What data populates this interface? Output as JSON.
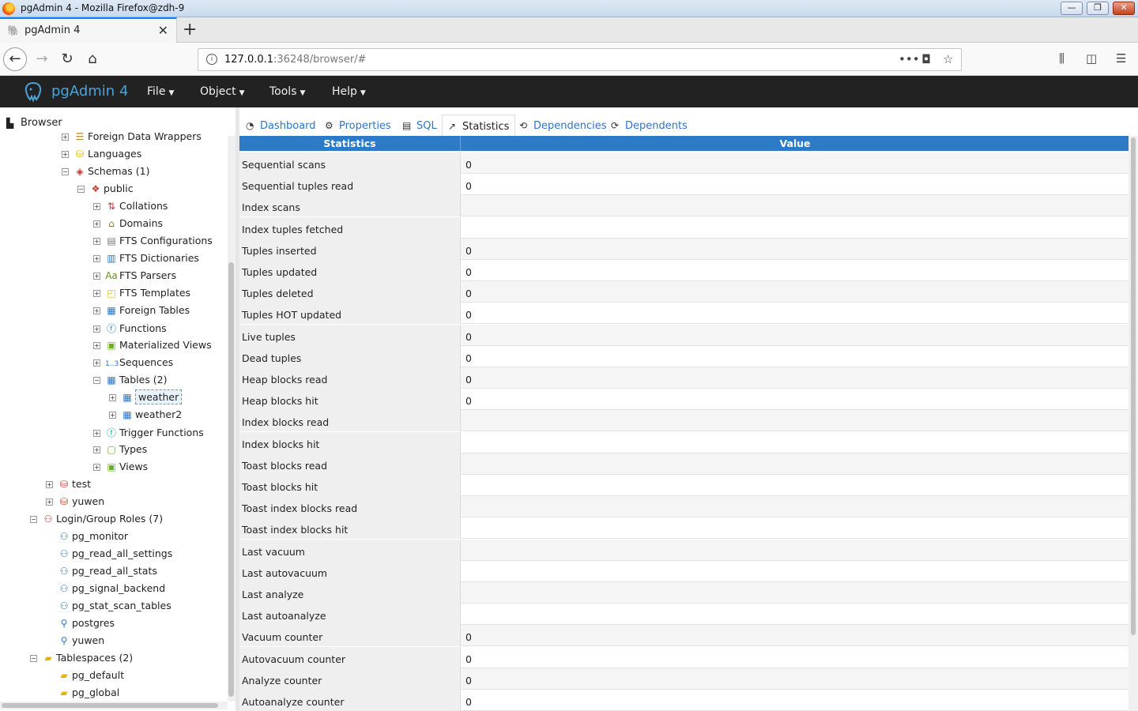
{
  "window": {
    "title": "pgAdmin 4 - Mozilla Firefox@zdh-9",
    "minimize": "—",
    "restore": "❐",
    "close": "✕"
  },
  "browser_tab": {
    "title": "pgAdmin 4",
    "close": "✕",
    "new_tab": "+"
  },
  "address": {
    "host": "127.0.0.1",
    "rest": ":36248/browser/#"
  },
  "app": {
    "brand": "pgAdmin 4",
    "menus": [
      {
        "label": "File"
      },
      {
        "label": "Object"
      },
      {
        "label": "Tools"
      },
      {
        "label": "Help"
      }
    ]
  },
  "browser_panel": {
    "title": "Browser",
    "tree": [
      {
        "label": "Foreign Data Wrappers",
        "indent": 4,
        "icon": "fdw-icon",
        "glyph": "☰",
        "color": "#b08a2a",
        "exp": "+"
      },
      {
        "label": "Languages",
        "indent": 4,
        "icon": "languages-icon",
        "glyph": "⛁",
        "color": "#d9b600",
        "exp": "+"
      },
      {
        "label": "Schemas (1)",
        "indent": 4,
        "icon": "schemas-icon",
        "glyph": "◈",
        "color": "#c0392b",
        "exp": "−"
      },
      {
        "label": "public",
        "indent": 5,
        "icon": "schema-public-icon",
        "glyph": "❖",
        "color": "#c0392b",
        "exp": "−"
      },
      {
        "label": "Collations",
        "indent": 6,
        "icon": "collations-icon",
        "glyph": "⇅",
        "color": "#c0392b",
        "exp": "+"
      },
      {
        "label": "Domains",
        "indent": 6,
        "icon": "domains-icon",
        "glyph": "⌂",
        "color": "#8a6d3b",
        "exp": "+"
      },
      {
        "label": "FTS Configurations",
        "indent": 6,
        "icon": "fts-configurations-icon",
        "glyph": "▤",
        "color": "#777777",
        "exp": "+"
      },
      {
        "label": "FTS Dictionaries",
        "indent": 6,
        "icon": "fts-dictionaries-icon",
        "glyph": "▥",
        "color": "#2c76c7",
        "exp": "+"
      },
      {
        "label": "FTS Parsers",
        "indent": 6,
        "icon": "fts-parsers-icon",
        "glyph": "Aa",
        "color": "#6b8e23",
        "exp": "+"
      },
      {
        "label": "FTS Templates",
        "indent": 6,
        "icon": "fts-templates-icon",
        "glyph": "◰",
        "color": "#d9b600",
        "exp": "+"
      },
      {
        "label": "Foreign Tables",
        "indent": 6,
        "icon": "foreign-tables-icon",
        "glyph": "▦",
        "color": "#2c76c7",
        "exp": "+"
      },
      {
        "label": "Functions",
        "indent": 6,
        "icon": "functions-icon",
        "glyph": "ⓕ",
        "color": "#2c76c7",
        "exp": "+"
      },
      {
        "label": "Materialized Views",
        "indent": 6,
        "icon": "materialized-views-icon",
        "glyph": "▣",
        "color": "#6ab023",
        "exp": "+"
      },
      {
        "label": "Sequences",
        "indent": 6,
        "icon": "sequences-icon",
        "glyph": "1..3",
        "color": "#2c76c7",
        "exp": "+"
      },
      {
        "label": "Tables (2)",
        "indent": 6,
        "icon": "tables-icon",
        "glyph": "▦",
        "color": "#2c76c7",
        "exp": "−"
      },
      {
        "label": "weather",
        "indent": 7,
        "icon": "table-icon",
        "glyph": "▦",
        "color": "#2c76c7",
        "exp": "+",
        "selected": true
      },
      {
        "label": "weather2",
        "indent": 7,
        "icon": "table-icon",
        "glyph": "▦",
        "color": "#2c76c7",
        "exp": "+"
      },
      {
        "label": "Trigger Functions",
        "indent": 6,
        "icon": "trigger-functions-icon",
        "glyph": "ⓕ",
        "color": "#16a085",
        "exp": "+"
      },
      {
        "label": "Types",
        "indent": 6,
        "icon": "types-icon",
        "glyph": "▢",
        "color": "#6ab023",
        "exp": "+"
      },
      {
        "label": "Views",
        "indent": 6,
        "icon": "views-icon",
        "glyph": "▣",
        "color": "#6ab023",
        "exp": "+"
      },
      {
        "label": "test",
        "indent": 3,
        "icon": "database-icon",
        "glyph": "⛁",
        "color": "#c0392b",
        "exp": "+"
      },
      {
        "label": "yuwen",
        "indent": 3,
        "icon": "database-icon",
        "glyph": "⛁",
        "color": "#c0392b",
        "exp": "+"
      },
      {
        "label": "Login/Group Roles (7)",
        "indent": 2,
        "icon": "roles-icon",
        "glyph": "⚇",
        "color": "#c0392b",
        "exp": "−"
      },
      {
        "label": "pg_monitor",
        "indent": 3,
        "icon": "group-role-icon",
        "glyph": "⚇",
        "color": "#2c76c7",
        "exp": ""
      },
      {
        "label": "pg_read_all_settings",
        "indent": 3,
        "icon": "group-role-icon",
        "glyph": "⚇",
        "color": "#2c76c7",
        "exp": ""
      },
      {
        "label": "pg_read_all_stats",
        "indent": 3,
        "icon": "group-role-icon",
        "glyph": "⚇",
        "color": "#2c76c7",
        "exp": ""
      },
      {
        "label": "pg_signal_backend",
        "indent": 3,
        "icon": "group-role-icon",
        "glyph": "⚇",
        "color": "#2c76c7",
        "exp": ""
      },
      {
        "label": "pg_stat_scan_tables",
        "indent": 3,
        "icon": "group-role-icon",
        "glyph": "⚇",
        "color": "#2c76c7",
        "exp": ""
      },
      {
        "label": "postgres",
        "indent": 3,
        "icon": "login-role-icon",
        "glyph": "⚲",
        "color": "#2c76c7",
        "exp": ""
      },
      {
        "label": "yuwen",
        "indent": 3,
        "icon": "login-role-icon",
        "glyph": "⚲",
        "color": "#2c76c7",
        "exp": ""
      },
      {
        "label": "Tablespaces (2)",
        "indent": 2,
        "icon": "tablespaces-icon",
        "glyph": "▰",
        "color": "#e0b400",
        "exp": "−"
      },
      {
        "label": "pg_default",
        "indent": 3,
        "icon": "tablespace-icon",
        "glyph": "▰",
        "color": "#e0b400",
        "exp": ""
      },
      {
        "label": "pg_global",
        "indent": 3,
        "icon": "tablespace-icon",
        "glyph": "▰",
        "color": "#e0b400",
        "exp": ""
      }
    ]
  },
  "panel_tabs": [
    {
      "label": "Dashboard",
      "icon": "dashboard-icon",
      "glyph": "◔",
      "active": false
    },
    {
      "label": "Properties",
      "icon": "properties-icon",
      "glyph": "⚙",
      "active": false
    },
    {
      "label": "SQL",
      "icon": "sql-icon",
      "glyph": "▤",
      "active": false
    },
    {
      "label": "Statistics",
      "icon": "statistics-icon",
      "glyph": "↗",
      "active": true
    },
    {
      "label": "Dependencies",
      "icon": "dependencies-icon",
      "glyph": "⟲",
      "active": false
    },
    {
      "label": "Dependents",
      "icon": "dependents-icon",
      "glyph": "⟳",
      "active": false
    }
  ],
  "statistics": {
    "headers": {
      "name": "Statistics",
      "value": "Value"
    },
    "rows": [
      {
        "name": "Sequential scans",
        "value": "0"
      },
      {
        "name": "Sequential tuples read",
        "value": "0"
      },
      {
        "name": "Index scans",
        "value": ""
      },
      {
        "name": "Index tuples fetched",
        "value": ""
      },
      {
        "name": "Tuples inserted",
        "value": "0"
      },
      {
        "name": "Tuples updated",
        "value": "0"
      },
      {
        "name": "Tuples deleted",
        "value": "0"
      },
      {
        "name": "Tuples HOT updated",
        "value": "0"
      },
      {
        "name": "Live tuples",
        "value": "0"
      },
      {
        "name": "Dead tuples",
        "value": "0"
      },
      {
        "name": "Heap blocks read",
        "value": "0"
      },
      {
        "name": "Heap blocks hit",
        "value": "0"
      },
      {
        "name": "Index blocks read",
        "value": ""
      },
      {
        "name": "Index blocks hit",
        "value": ""
      },
      {
        "name": "Toast blocks read",
        "value": ""
      },
      {
        "name": "Toast blocks hit",
        "value": ""
      },
      {
        "name": "Toast index blocks read",
        "value": ""
      },
      {
        "name": "Toast index blocks hit",
        "value": ""
      },
      {
        "name": "Last vacuum",
        "value": ""
      },
      {
        "name": "Last autovacuum",
        "value": ""
      },
      {
        "name": "Last analyze",
        "value": ""
      },
      {
        "name": "Last autoanalyze",
        "value": ""
      },
      {
        "name": "Vacuum counter",
        "value": "0"
      },
      {
        "name": "Autovacuum counter",
        "value": "0"
      },
      {
        "name": "Analyze counter",
        "value": "0"
      },
      {
        "name": "Autoanalyze counter",
        "value": "0"
      }
    ]
  }
}
